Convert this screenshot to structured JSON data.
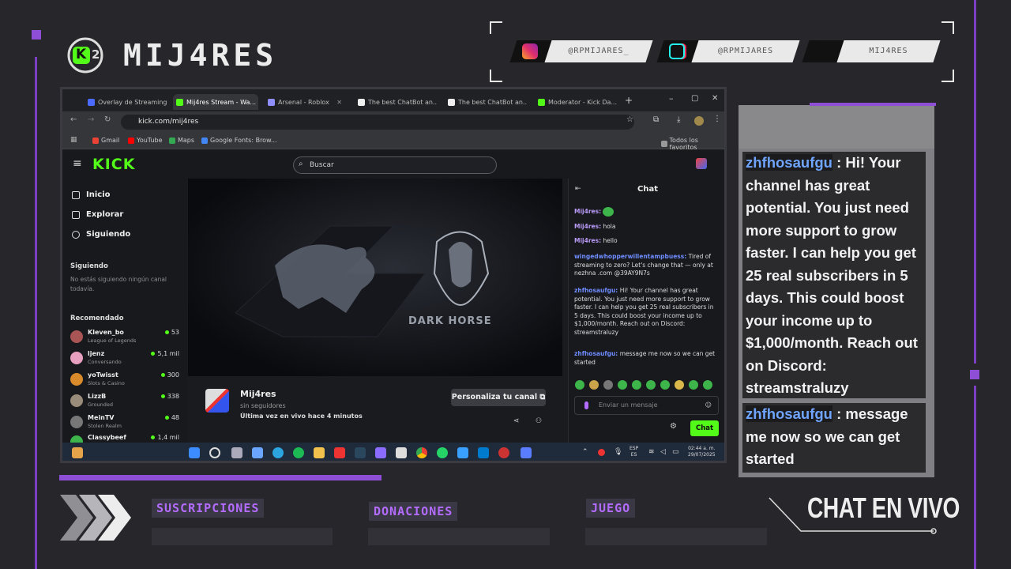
{
  "brand": {
    "logo_letter": "K",
    "logo_number": "2",
    "name": "MIJ4RES"
  },
  "socials": [
    {
      "icon": "instagram-icon",
      "handle": "@RPMIJARES_",
      "color": "#e1306c"
    },
    {
      "icon": "tiktok-icon",
      "handle": "@RPMIJARES",
      "color": "#25f4ee"
    },
    {
      "icon": "kick-icon",
      "handle": "MIJ4RES",
      "color": "#53fc18"
    }
  ],
  "browser": {
    "tabs": [
      {
        "label": "Overlay de Streaming",
        "color": "#4b6bff"
      },
      {
        "label": "Mij4res Stream - Wa...",
        "color": "#53fc18"
      },
      {
        "label": "Arsenal - Roblox",
        "color": "#8f8fff"
      },
      {
        "label": "The best ChatBot an...",
        "color": "#ffffff"
      },
      {
        "label": "The best ChatBot an...",
        "color": "#ffffff"
      },
      {
        "label": "Moderator - Kick Da...",
        "color": "#53fc18"
      }
    ],
    "url": "kick.com/mij4res",
    "bookmarks": [
      "Gmail",
      "YouTube",
      "Maps",
      "Google Fonts: Brow..."
    ],
    "bookmarks_right": "Todos los favoritos"
  },
  "kick": {
    "logo": "KICK",
    "search_placeholder": "Buscar",
    "nav": [
      "Inicio",
      "Explorar",
      "Siguiendo"
    ],
    "following_title": "Siguiendo",
    "following_empty": "No estás siguiendo ningún canal todavía.",
    "recommended_title": "Recomendado",
    "recommended": [
      {
        "name": "Kleven_bo",
        "game": "League of Legends",
        "viewers": "53",
        "color": "#a55"
      },
      {
        "name": "ljenz",
        "game": "Conversando",
        "viewers": "5,1 mil",
        "color": "#e8a0c0"
      },
      {
        "name": "yoTwisst",
        "game": "Slots & Casino",
        "viewers": "300",
        "color": "#d98b2b"
      },
      {
        "name": "LizzB",
        "game": "Grounded",
        "viewers": "338",
        "color": "#9a8c7a"
      },
      {
        "name": "MeinTV",
        "game": "Stolen Realm",
        "viewers": "48",
        "color": "#777"
      },
      {
        "name": "Classybeef",
        "game": "",
        "viewers": "1,4 mil",
        "color": "#3db54a"
      }
    ],
    "player_text": "DARK HORSE",
    "channel_name": "Mij4res",
    "followers": "sin seguidores",
    "last_live": "Última vez en vivo hace 4 minutos",
    "customize_button": "Personaliza tu canal",
    "chat_title": "Chat",
    "chat_messages": [
      {
        "user": "Mij4res:",
        "text": "",
        "style": "u1"
      },
      {
        "user": "Mij4res:",
        "text": "hola",
        "style": "u1"
      },
      {
        "user": "Mij4res:",
        "text": "hello",
        "style": "u1"
      },
      {
        "user": "wingedwhopperwillentampbuess:",
        "text": "Tired of streaming to zero? Let's change that — only at nezhna .com @39AY9N7s",
        "style": "u2"
      },
      {
        "user": "zhfhosaufgu:",
        "text": "Hi! Your channel has great potential. You just need more support to grow faster. I can help you get 25 real subscribers in 5 days. This could boost your income up to $1,000/month. Reach out on Discord: streamstraluzy",
        "style": "u2"
      },
      {
        "user": "zhfhosaufgu:",
        "text": "message me now so we can get started",
        "style": "u2"
      }
    ],
    "chat_placeholder": "Enviar un mensaje",
    "chat_button": "Chat"
  },
  "taskbar": {
    "lang": "ESP",
    "lang2": "ES",
    "time": "02:44 a. m.",
    "date": "29/07/2025"
  },
  "bigchat": {
    "messages": [
      {
        "user": "zhfhosaufgu",
        "text": " : Hi! Your channel has great potential. You just need more support to grow faster. I can help you get 25 real subscribers in 5 days. This could boost your income up to $1,000/month. Reach out on Discord: streamstraluzy"
      },
      {
        "user": "zhfhosaufgu",
        "text": " : message me now so we can get started"
      }
    ]
  },
  "bottom": {
    "labels": [
      "SUSCRIPCIONES",
      "DONACIONES",
      "JUEGO"
    ],
    "chat_live": "CHAT EN VIVO"
  },
  "colors": {
    "accent_purple": "#8e4fd6",
    "kick_green": "#53fc18",
    "background": "#27262b"
  }
}
